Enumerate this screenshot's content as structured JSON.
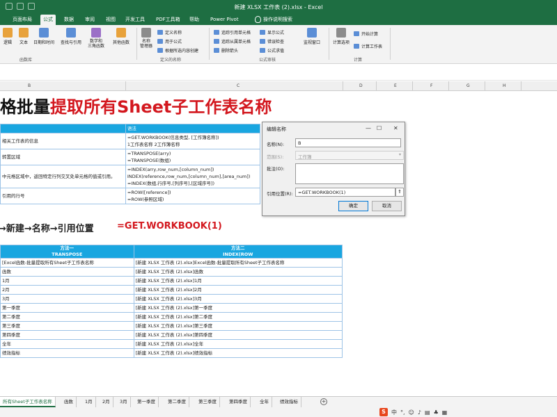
{
  "window": {
    "title": "新建 XLSX 工作表 (2).xlsx  -  Excel"
  },
  "ribbon_tabs": [
    {
      "label": "页面布局"
    },
    {
      "label": "公式"
    },
    {
      "label": "数据"
    },
    {
      "label": "审阅"
    },
    {
      "label": "视图"
    },
    {
      "label": "开发工具"
    },
    {
      "label": "PDF工具箱"
    },
    {
      "label": "帮助"
    },
    {
      "label": "Power Pivot"
    },
    {
      "label": "操作说明搜索"
    }
  ],
  "ribbon": {
    "buttons": {
      "logic": "逻辑",
      "text": "文本",
      "datetime": "日期和时间",
      "lookup": "查找与引用",
      "math": "数学和\n三角函数",
      "more": "其他函数",
      "name_manager": "名称\n管理器",
      "watch_window": "监视窗口",
      "calc_options": "计算选项"
    },
    "names": {
      "define_name": "定义名称",
      "use_in_formula": "用于公式",
      "create_from_selection": "根据所选内容创建"
    },
    "audit": {
      "trace_precedents": "追踪引用单元格",
      "trace_dependents": "追踪从属单元格",
      "remove_arrows": "删除箭头",
      "show_formulas": "显示公式",
      "error_check": "错误检查",
      "evaluate": "公式求值"
    },
    "calc": {
      "calc_now": "开始计算",
      "calc_sheet": "计算工作表"
    },
    "groups": {
      "function_library": "函数库",
      "defined_names": "定义的名称",
      "formula_auditing": "公式审核",
      "calculation": "计算"
    }
  },
  "columns": [
    "B",
    "C",
    "D",
    "E",
    "F",
    "G",
    "H"
  ],
  "heading": {
    "part1": "表格批量",
    "part2": "提取所有Sheet子工作表名称"
  },
  "top_table": {
    "header": [
      "",
      "语法"
    ],
    "rows": [
      {
        "a": "相关工作表的信息",
        "b": [
          "=GET.WORKBOOK(信息类型, [工作簿名称])",
          "1工作表名称 2工作簿名称"
        ]
      },
      {
        "a": "转置区域",
        "b": [
          "=TRANSPOSE(arry)",
          "=TRANSPOSE(数组)"
        ]
      },
      {
        "a": "中元格区域中，返回特定行列交叉处单元格的值或引用。",
        "b": [
          "=INDEX(arry,row_num,[column_num])",
          "INDEX(reference,row_num,[column_num],[area_num])",
          "=INDEX(数组,行序号,[列序号],[区域序号])"
        ]
      },
      {
        "a": "引用的行号",
        "b": [
          "=ROW([reference])",
          "=ROW(参照区域)"
        ]
      }
    ]
  },
  "dialog": {
    "title": "编辑名称",
    "name_label": "名称(N):",
    "name_value": "B",
    "scope_label": "范围(S):",
    "scope_value": "工作簿",
    "comment_label": "批注(O):",
    "refers_label": "引用位置(R):",
    "refers_value": "=GET.WORKBOOK(1)",
    "ok": "确定",
    "cancel": "取消"
  },
  "step": {
    "text": "公式→新建→名称→引用位置",
    "formula": "=GET.WORKBOOK(1)"
  },
  "bottom_table": {
    "header": [
      {
        "line1": "方法一",
        "line2": "TRANSPOSE"
      },
      {
        "line1": "方法二",
        "line2": "INDEX(ROW"
      }
    ],
    "rows": [
      [
        "[Excel函数-批量提取所有Sheet子工作表名称",
        "[新建 XLSX 工作表 (2).xlsx]Excel函数-批量提取所有Sheet子工作表名称"
      ],
      [
        "函数",
        "[新建 XLSX 工作表 (2).xlsx]函数"
      ],
      [
        "1月",
        "[新建 XLSX 工作表 (2).xlsx]1月"
      ],
      [
        "2月",
        "[新建 XLSX 工作表 (2).xlsx]2月"
      ],
      [
        "3月",
        "[新建 XLSX 工作表 (2).xlsx]3月"
      ],
      [
        "第一季度",
        "[新建 XLSX 工作表 (2).xlsx]第一季度"
      ],
      [
        "第二季度",
        "[新建 XLSX 工作表 (2).xlsx]第二季度"
      ],
      [
        "第三季度",
        "[新建 XLSX 工作表 (2).xlsx]第三季度"
      ],
      [
        "第四季度",
        "[新建 XLSX 工作表 (2).xlsx]第四季度"
      ],
      [
        "全年",
        "[新建 XLSX 工作表 (2).xlsx]全年"
      ],
      [
        "绩效指标",
        "[新建 XLSX 工作表 (2).xlsx]绩效指标"
      ]
    ]
  },
  "sheet_tabs": [
    {
      "label": "所有Sheet子工作表名称"
    },
    {
      "label": "函数"
    },
    {
      "label": "1月"
    },
    {
      "label": "2月"
    },
    {
      "label": "3月"
    },
    {
      "label": "第一季度"
    },
    {
      "label": "第二季度"
    },
    {
      "label": "第三季度"
    },
    {
      "label": "第四季度"
    },
    {
      "label": "全年"
    },
    {
      "label": "绩效指标"
    }
  ],
  "colors": {
    "excel_green": "#1e6e42",
    "table_header": "#19a6e0",
    "heading_red": "#d3171e"
  }
}
